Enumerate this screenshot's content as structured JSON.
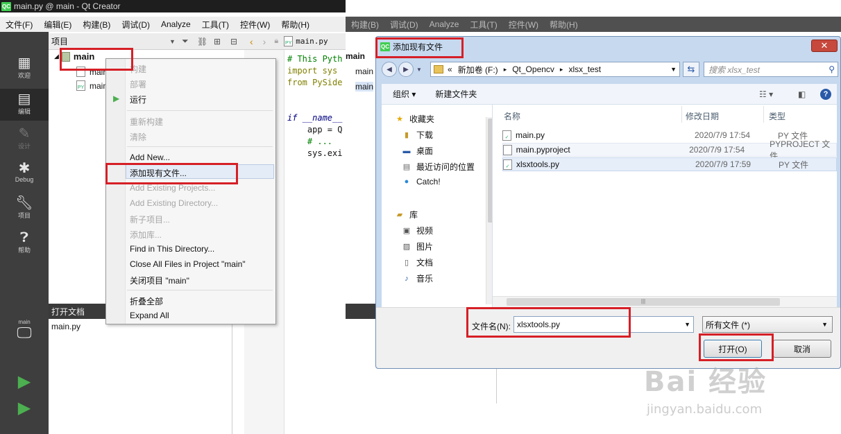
{
  "left_window": {
    "title": "main.py @ main - Qt Creator",
    "menu": [
      "文件(F)",
      "编辑(E)",
      "构建(B)",
      "调试(D)",
      "Analyze",
      "工具(T)",
      "控件(W)",
      "帮助(H)"
    ],
    "modes": [
      {
        "label": "欢迎",
        "icon": "grid-icon"
      },
      {
        "label": "编辑",
        "icon": "edit-icon"
      },
      {
        "label": "设计",
        "icon": "pencil-icon"
      },
      {
        "label": "Debug",
        "icon": "bug-icon"
      },
      {
        "label": "项目",
        "icon": "wrench-icon"
      },
      {
        "label": "帮助",
        "icon": "help-icon"
      }
    ],
    "kit_label": "main",
    "projects_header": "项目",
    "tree": {
      "root": "main",
      "children": [
        "main",
        "main"
      ]
    },
    "open_docs_header": "打开文档",
    "open_docs": [
      "main.py"
    ],
    "editor_tab": "main.py",
    "code_lines": [
      "# This Pyth",
      "import sys",
      "from PySide",
      "",
      "if __name__",
      "    app = Q",
      "    # ...",
      "    sys.exi"
    ]
  },
  "context_menu": {
    "items": [
      {
        "label": "构建",
        "disabled": true
      },
      {
        "label": "部署",
        "disabled": true
      },
      {
        "label": "运行",
        "disabled": false
      },
      {
        "label": "重新构建",
        "disabled": true
      },
      {
        "label": "清除",
        "disabled": true
      },
      {
        "label": "Add New...",
        "disabled": false
      },
      {
        "label": "添加现有文件...",
        "disabled": false
      },
      {
        "label": "Add Existing Projects...",
        "disabled": true
      },
      {
        "label": "Add Existing Directory...",
        "disabled": true
      },
      {
        "label": "新子项目...",
        "disabled": true
      },
      {
        "label": "添加库...",
        "disabled": true
      },
      {
        "label": "Find in This Directory...",
        "disabled": false
      },
      {
        "label": "Close All Files in Project \"main\"",
        "disabled": false
      },
      {
        "label": "关闭项目 \"main\"",
        "disabled": false
      },
      {
        "label": "折叠全部",
        "disabled": false
      },
      {
        "label": "Expand All",
        "disabled": false
      }
    ]
  },
  "background_window": {
    "menu": [
      "构建(B)",
      "调试(D)",
      "Analyze",
      "工具(T)",
      "控件(W)",
      "帮助(H)"
    ],
    "editor_peek": [
      "main",
      "main",
      "main"
    ]
  },
  "dialog": {
    "title": "添加现有文件",
    "close": "✕",
    "address": {
      "prefix": "«",
      "parts": [
        "新加卷 (F:)",
        "Qt_Opencv",
        "xlsx_test"
      ]
    },
    "search_placeholder": "搜索 xlsx_test",
    "organize": "组织 ▾",
    "new_folder": "新建文件夹",
    "nav": {
      "favorites_header": "收藏夹",
      "favorites": [
        "下载",
        "桌面",
        "最近访问的位置",
        "Catch!"
      ],
      "library_header": "库",
      "libraries": [
        "视频",
        "图片",
        "文档",
        "音乐"
      ]
    },
    "columns": {
      "name": "名称",
      "date": "修改日期",
      "type": "类型"
    },
    "files": [
      {
        "name": "main.py",
        "date": "2020/7/9 17:54",
        "type": "PY 文件"
      },
      {
        "name": "main.pyproject",
        "date": "2020/7/9 17:54",
        "type": "PYPROJECT 文件"
      },
      {
        "name": "xlsxtools.py",
        "date": "2020/7/9 17:59",
        "type": "PY 文件"
      }
    ],
    "filename_label": "文件名(N):",
    "filename_value": "xlsxtools.py",
    "filter_value": "所有文件 (*)",
    "open_button": "打开(O)",
    "cancel_button": "取消"
  },
  "watermark": {
    "brand": "Bai 经验",
    "url": "jingyan.baidu.com"
  },
  "colors": {
    "highlight": "#d61f26",
    "qt_green": "#41cd52",
    "dark_panel": "#3e3e3e"
  }
}
